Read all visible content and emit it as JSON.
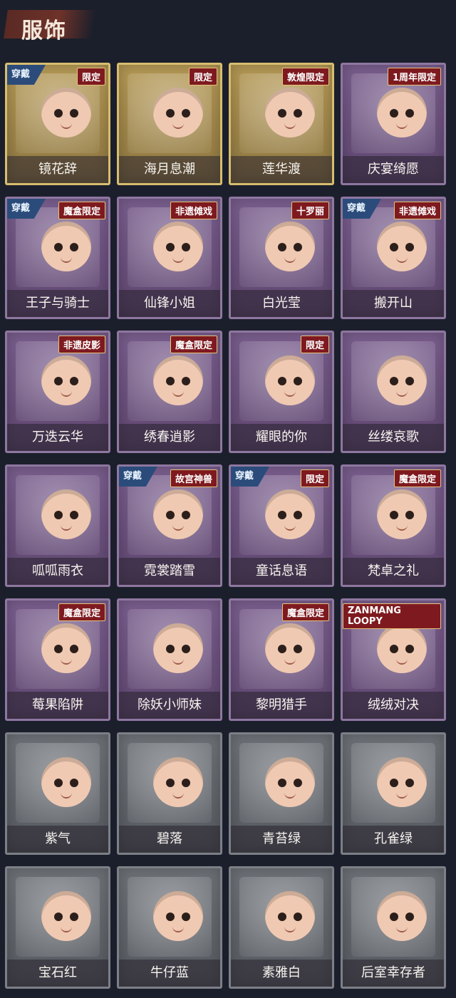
{
  "header": {
    "title": "服饰"
  },
  "cards": [
    {
      "name": "镜花辞",
      "tag": "限定",
      "worn": "穿戴",
      "style": "gold"
    },
    {
      "name": "海月息潮",
      "tag": "限定",
      "worn": "",
      "style": "gold"
    },
    {
      "name": "莲华渡",
      "tag": "敦煌限定",
      "worn": "",
      "style": "gold"
    },
    {
      "name": "庆宴绮愿",
      "tag": "1周年限定",
      "worn": "",
      "style": "purple"
    },
    {
      "name": "王子与骑士",
      "tag": "魔盒限定",
      "worn": "穿戴",
      "style": "purple"
    },
    {
      "name": "仙锋小姐",
      "tag": "非遗傩戏",
      "worn": "",
      "style": "purple"
    },
    {
      "name": "白光莹",
      "tag": "十罗丽",
      "worn": "",
      "style": "purple"
    },
    {
      "name": "搬开山",
      "tag": "非遗傩戏",
      "worn": "穿戴",
      "style": "purple"
    },
    {
      "name": "万迭云华",
      "tag": "非遗皮影",
      "worn": "",
      "style": "purple"
    },
    {
      "name": "绣春逍影",
      "tag": "魔盒限定",
      "worn": "",
      "style": "purple"
    },
    {
      "name": "耀眼的你",
      "tag": "限定",
      "worn": "",
      "style": "purple"
    },
    {
      "name": "丝缕哀歌",
      "tag": "",
      "worn": "",
      "style": "purple"
    },
    {
      "name": "呱呱雨衣",
      "tag": "",
      "worn": "",
      "style": "purple"
    },
    {
      "name": "霓裳踏雪",
      "tag": "故宫神兽",
      "worn": "穿戴",
      "style": "purple"
    },
    {
      "name": "童话息语",
      "tag": "限定",
      "worn": "穿戴",
      "style": "purple"
    },
    {
      "name": "梵卓之礼",
      "tag": "魔盒限定",
      "worn": "",
      "style": "purple"
    },
    {
      "name": "莓果陷阱",
      "tag": "魔盒限定",
      "worn": "",
      "style": "purple"
    },
    {
      "name": "除妖小师妹",
      "tag": "",
      "worn": "",
      "style": "purple"
    },
    {
      "name": "黎明猎手",
      "tag": "魔盒限定",
      "worn": "",
      "style": "purple"
    },
    {
      "name": "绒绒对决",
      "tag": "ZANMANG LOOPY",
      "worn": "",
      "style": "purple"
    },
    {
      "name": "紫气",
      "tag": "",
      "worn": "",
      "style": "gray"
    },
    {
      "name": "碧落",
      "tag": "",
      "worn": "",
      "style": "gray"
    },
    {
      "name": "青苔绿",
      "tag": "",
      "worn": "",
      "style": "gray"
    },
    {
      "name": "孔雀绿",
      "tag": "",
      "worn": "",
      "style": "gray"
    },
    {
      "name": "宝石红",
      "tag": "",
      "worn": "",
      "style": "gray"
    },
    {
      "name": "牛仔蓝",
      "tag": "",
      "worn": "",
      "style": "gray"
    },
    {
      "name": "素雅白",
      "tag": "",
      "worn": "",
      "style": "gray"
    },
    {
      "name": "后室幸存者",
      "tag": "",
      "worn": "",
      "style": "gray"
    }
  ]
}
